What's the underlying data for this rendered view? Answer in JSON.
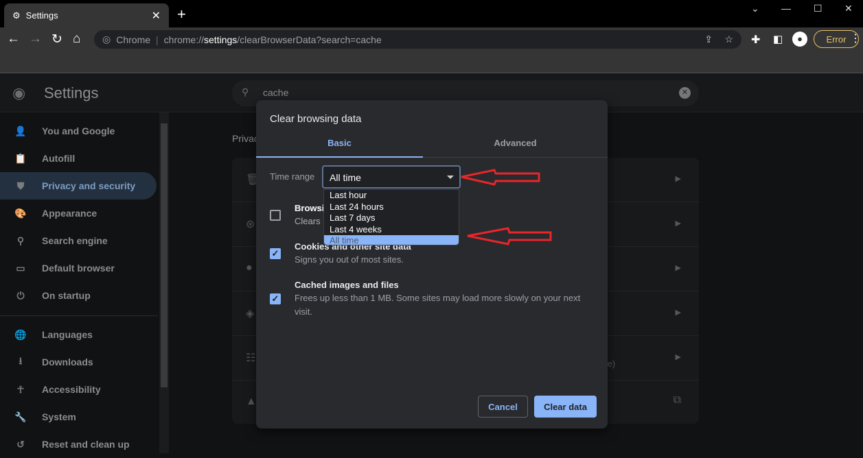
{
  "browser": {
    "tab_title": "Settings",
    "new_tab": "+",
    "omnibox_label": "Chrome",
    "url_prefix": "chrome://",
    "url_bold": "settings",
    "url_suffix": "/clearBrowserData?search=cache",
    "profile_status": "Error"
  },
  "settings": {
    "title": "Settings",
    "search_value": "cache",
    "section_title": "Privacy and security",
    "sidebar": [
      {
        "label": "You and Google",
        "icon": "person-icon"
      },
      {
        "label": "Autofill",
        "icon": "clipboard-icon"
      },
      {
        "label": "Privacy and security",
        "icon": "shield-icon"
      },
      {
        "label": "Appearance",
        "icon": "palette-icon"
      },
      {
        "label": "Search engine",
        "icon": "search-icon"
      },
      {
        "label": "Default browser",
        "icon": "browser-icon"
      },
      {
        "label": "On startup",
        "icon": "power-icon"
      },
      {
        "label": "Languages",
        "icon": "globe-icon"
      },
      {
        "label": "Downloads",
        "icon": "download-icon"
      },
      {
        "label": "Accessibility",
        "icon": "accessibility-icon"
      },
      {
        "label": "System",
        "icon": "wrench-icon"
      },
      {
        "label": "Reset and clean up",
        "icon": "history-icon"
      }
    ],
    "card_partial_text": "ore)"
  },
  "dialog": {
    "title": "Clear browsing data",
    "tabs": [
      "Basic",
      "Advanced"
    ],
    "time_range_label": "Time range",
    "time_range_value": "All time",
    "options": [
      "Last hour",
      "Last 24 hours",
      "Last 7 days",
      "Last 4 weeks",
      "All time"
    ],
    "items": [
      {
        "title": "Browsing history",
        "subtitle": "Clears history",
        "checked": false,
        "visible_title": "Browsi",
        "visible_subtitle": "Clears l"
      },
      {
        "title": "Cookies and other site data",
        "subtitle": "Signs you out of most sites.",
        "checked": true
      },
      {
        "title": "Cached images and files",
        "subtitle": "Frees up less than 1 MB. Some sites may load more slowly on your next visit.",
        "checked": true
      }
    ],
    "cancel": "Cancel",
    "clear": "Clear data"
  },
  "colors": {
    "accent": "#8ab4f8",
    "annotation_arrow": "#e8262a"
  }
}
